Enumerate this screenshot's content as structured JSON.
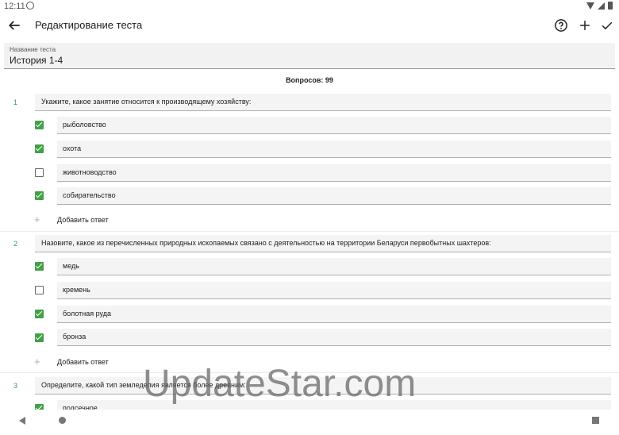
{
  "status": {
    "time": "12:11"
  },
  "appbar": {
    "title": "Редактирование теста",
    "back_icon": "arrow-left-icon",
    "help_icon": "help-circle-icon",
    "add_icon": "plus-icon",
    "save_icon": "check-icon"
  },
  "test_name": {
    "label": "Название теста",
    "value": "История 1-4"
  },
  "questions_count": "Вопросов: 99",
  "add_answer_label": "Добавить ответ",
  "questions": [
    {
      "number": "1",
      "text": "Укажите, какое занятие относится к производящему хозяйству:",
      "answers": [
        {
          "text": "рыболовство",
          "checked": true
        },
        {
          "text": "охота",
          "checked": true
        },
        {
          "text": "животноводство",
          "checked": false
        },
        {
          "text": "собирательство",
          "checked": true
        }
      ]
    },
    {
      "number": "2",
      "text": "Назовите, какое из перечисленных природных ископаемых связано с деятельностью на территории Беларуси первобытных шахтеров:",
      "answers": [
        {
          "text": "медь",
          "checked": true
        },
        {
          "text": "кремень",
          "checked": false
        },
        {
          "text": "болотная руда",
          "checked": true
        },
        {
          "text": "бронза",
          "checked": true
        }
      ]
    },
    {
      "number": "3",
      "text": "Определите, какой тип земледелия является более древним:",
      "answers": [
        {
          "text": "подсечное",
          "checked": true
        }
      ]
    }
  ],
  "watermark": "UpdateStar.com",
  "colors": {
    "accent": "#43a047",
    "number": "#3c8c94",
    "field_bg": "#f4f4f4"
  }
}
